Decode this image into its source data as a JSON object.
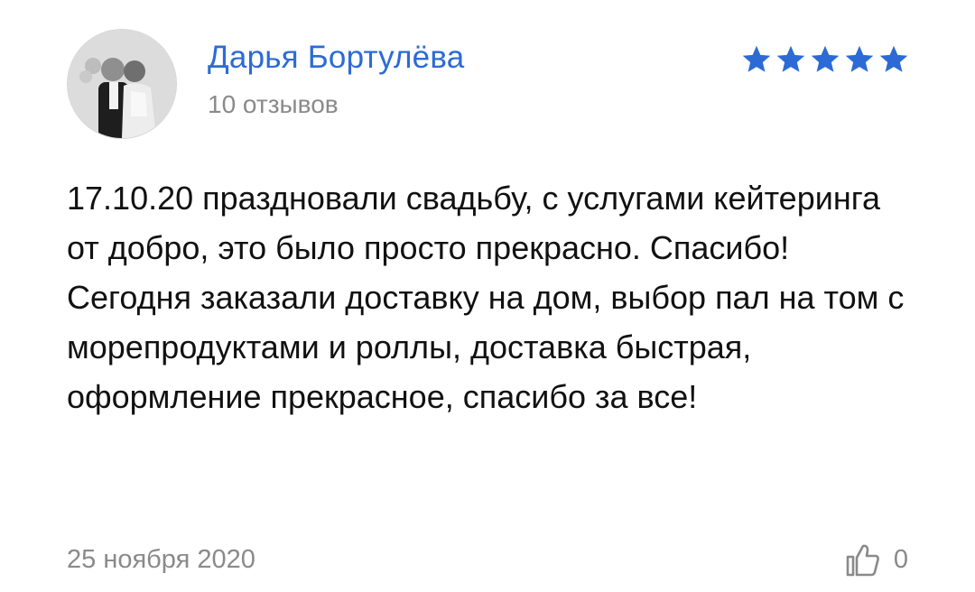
{
  "review": {
    "author": {
      "name": "Дарья Бортулёва",
      "reviews_count": "10 отзывов",
      "avatar_icon": "user-photo-avatar"
    },
    "rating": {
      "value": 5,
      "max": 5,
      "color": "#2c6bd6"
    },
    "text": "17.10.20 праздновали свадьбу, с услугами кейтеринга от добро, это было просто прекрасно. Спасибо!\nСегодня заказали доставку на дом, выбор пал на том с морепродуктами и роллы, доставка быстрая, оформление прекрасное, спасибо за все!",
    "date": "25 ноября 2020",
    "likes": "0",
    "like_icon": "thumbs-up-icon"
  },
  "colors": {
    "accent": "#2c6bd6",
    "muted": "#8a8a8a",
    "text": "#111111"
  }
}
